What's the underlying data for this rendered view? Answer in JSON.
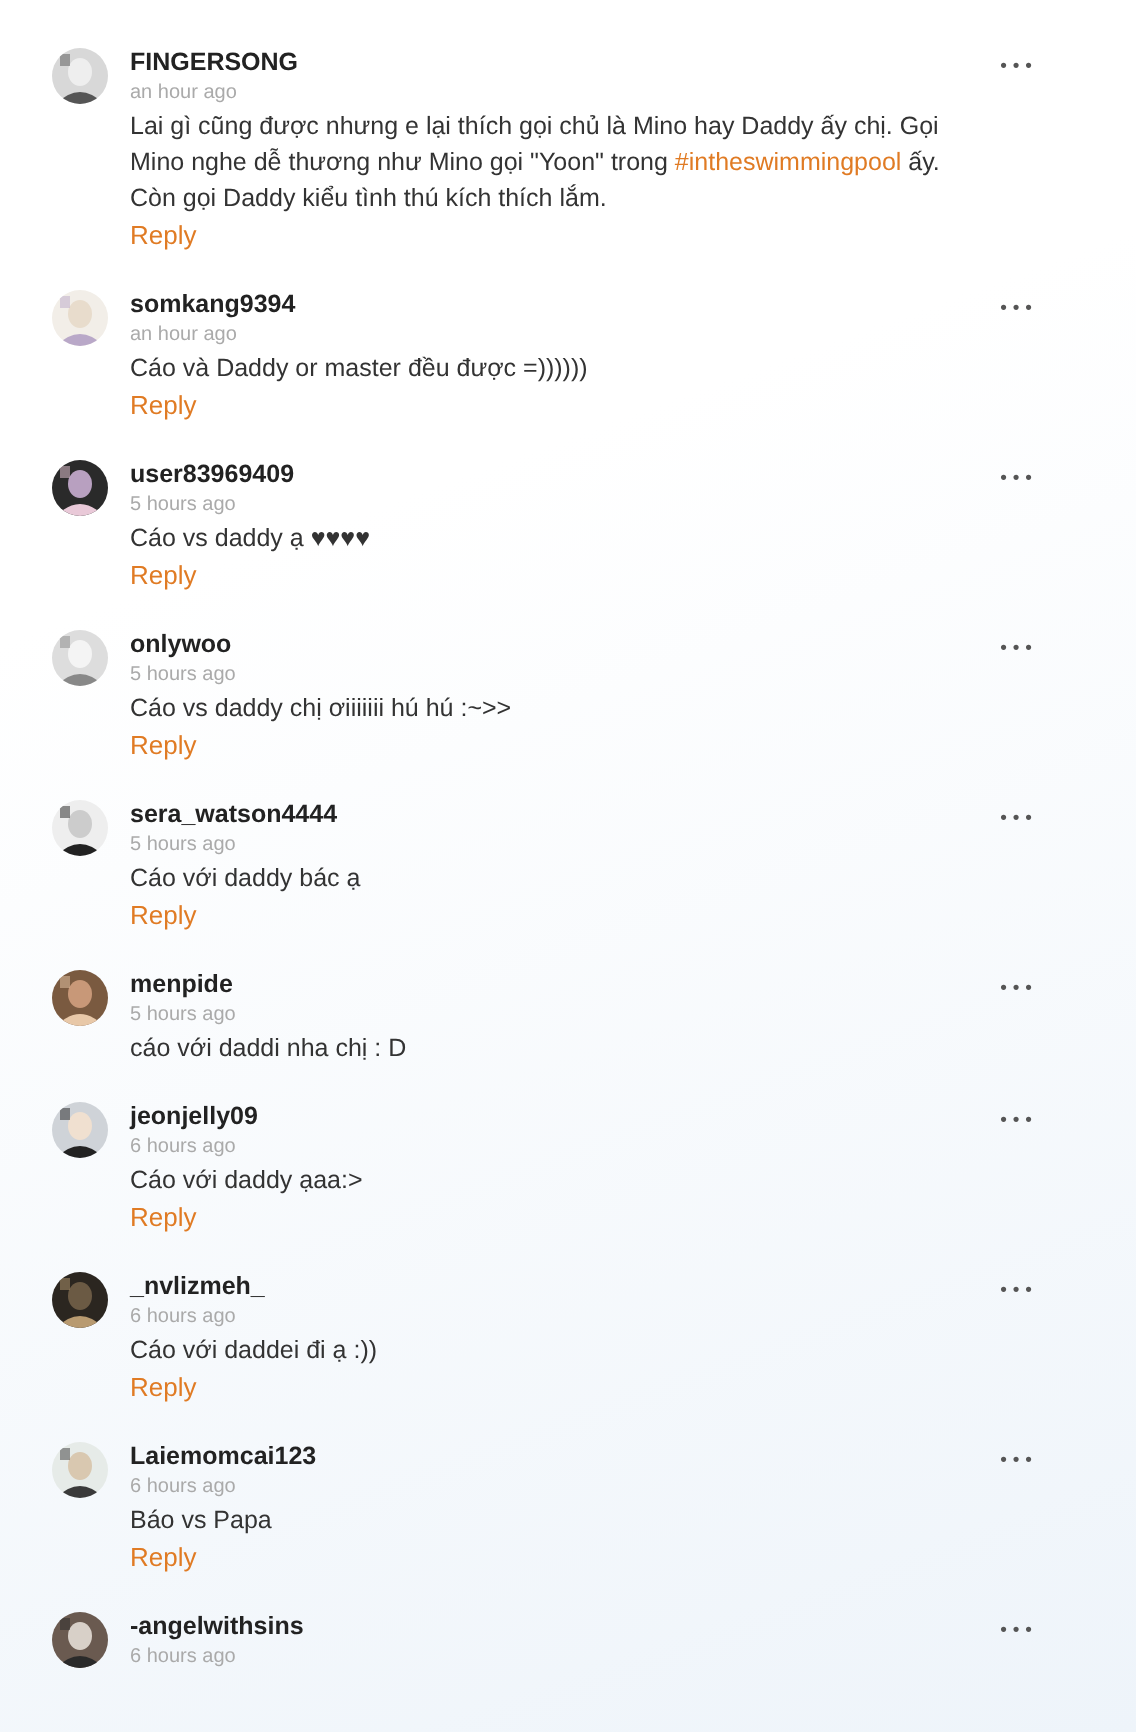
{
  "comments": [
    {
      "user": "FINGERSONG",
      "time": "an hour ago",
      "body": [
        {
          "kind": "text",
          "text": "Lai gì cũng được nhưng e lại thích gọi chủ là Mino hay Daddy ấy chị. Gọi Mino nghe dễ thương như Mino gọi \"Yoon\" trong "
        },
        {
          "kind": "hashtag",
          "text": "#intheswimmingpool"
        },
        {
          "kind": "text",
          "text": " ấy. Còn gọi Daddy kiểu tình thú kích thích lắm."
        }
      ],
      "reply": "Reply",
      "more": "•••"
    },
    {
      "user": "somkang9394",
      "time": "an hour ago",
      "body": [
        {
          "kind": "text",
          "text": "Cáo và Daddy or master đều được =))))))"
        }
      ],
      "reply": "Reply",
      "more": "•••"
    },
    {
      "user": "user83969409",
      "time": "5 hours ago",
      "body": [
        {
          "kind": "text",
          "text": "Cáo vs daddy ạ ♥♥♥♥"
        }
      ],
      "reply": "Reply",
      "more": "•••"
    },
    {
      "user": "onlywoo",
      "time": "5 hours ago",
      "body": [
        {
          "kind": "text",
          "text": "Cáo vs daddy chị ơiiiiiii hú hú :~>>"
        }
      ],
      "reply": "Reply",
      "more": "•••"
    },
    {
      "user": "sera_watson4444",
      "time": "5 hours ago",
      "body": [
        {
          "kind": "text",
          "text": "Cáo với daddy bác ạ"
        }
      ],
      "reply": "Reply",
      "more": "•••"
    },
    {
      "user": "menpide",
      "time": "5 hours ago",
      "body": [
        {
          "kind": "text",
          "text": "cáo với daddi nha chị : D"
        }
      ],
      "more": "•••"
    },
    {
      "user": "jeonjelly09",
      "time": "6 hours ago",
      "body": [
        {
          "kind": "text",
          "text": "Cáo với daddy ạaa:>"
        }
      ],
      "reply": "Reply",
      "more": "•••"
    },
    {
      "user": "_nvlizmeh_",
      "time": "6 hours ago",
      "body": [
        {
          "kind": "text",
          "text": "Cáo với daddei đi ạ :))"
        }
      ],
      "reply": "Reply",
      "more": "•••"
    },
    {
      "user": "Laiemomcai123",
      "time": "6 hours ago",
      "body": [
        {
          "kind": "text",
          "text": "Báo vs Papa"
        }
      ],
      "reply": "Reply",
      "more": "•••"
    },
    {
      "user": "-angelwithsins",
      "time": "6 hours ago",
      "more": "•••"
    }
  ]
}
